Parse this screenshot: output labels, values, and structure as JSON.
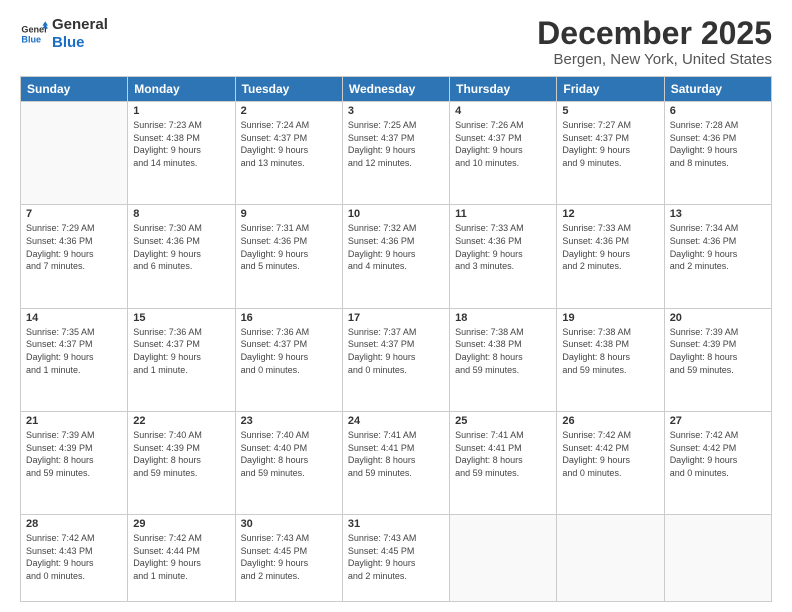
{
  "logo": {
    "line1": "General",
    "line2": "Blue"
  },
  "header": {
    "month": "December 2025",
    "location": "Bergen, New York, United States"
  },
  "weekdays": [
    "Sunday",
    "Monday",
    "Tuesday",
    "Wednesday",
    "Thursday",
    "Friday",
    "Saturday"
  ],
  "weeks": [
    [
      {
        "day": "",
        "info": ""
      },
      {
        "day": "1",
        "info": "Sunrise: 7:23 AM\nSunset: 4:38 PM\nDaylight: 9 hours\nand 14 minutes."
      },
      {
        "day": "2",
        "info": "Sunrise: 7:24 AM\nSunset: 4:37 PM\nDaylight: 9 hours\nand 13 minutes."
      },
      {
        "day": "3",
        "info": "Sunrise: 7:25 AM\nSunset: 4:37 PM\nDaylight: 9 hours\nand 12 minutes."
      },
      {
        "day": "4",
        "info": "Sunrise: 7:26 AM\nSunset: 4:37 PM\nDaylight: 9 hours\nand 10 minutes."
      },
      {
        "day": "5",
        "info": "Sunrise: 7:27 AM\nSunset: 4:37 PM\nDaylight: 9 hours\nand 9 minutes."
      },
      {
        "day": "6",
        "info": "Sunrise: 7:28 AM\nSunset: 4:36 PM\nDaylight: 9 hours\nand 8 minutes."
      }
    ],
    [
      {
        "day": "7",
        "info": "Sunrise: 7:29 AM\nSunset: 4:36 PM\nDaylight: 9 hours\nand 7 minutes."
      },
      {
        "day": "8",
        "info": "Sunrise: 7:30 AM\nSunset: 4:36 PM\nDaylight: 9 hours\nand 6 minutes."
      },
      {
        "day": "9",
        "info": "Sunrise: 7:31 AM\nSunset: 4:36 PM\nDaylight: 9 hours\nand 5 minutes."
      },
      {
        "day": "10",
        "info": "Sunrise: 7:32 AM\nSunset: 4:36 PM\nDaylight: 9 hours\nand 4 minutes."
      },
      {
        "day": "11",
        "info": "Sunrise: 7:33 AM\nSunset: 4:36 PM\nDaylight: 9 hours\nand 3 minutes."
      },
      {
        "day": "12",
        "info": "Sunrise: 7:33 AM\nSunset: 4:36 PM\nDaylight: 9 hours\nand 2 minutes."
      },
      {
        "day": "13",
        "info": "Sunrise: 7:34 AM\nSunset: 4:36 PM\nDaylight: 9 hours\nand 2 minutes."
      }
    ],
    [
      {
        "day": "14",
        "info": "Sunrise: 7:35 AM\nSunset: 4:37 PM\nDaylight: 9 hours\nand 1 minute."
      },
      {
        "day": "15",
        "info": "Sunrise: 7:36 AM\nSunset: 4:37 PM\nDaylight: 9 hours\nand 1 minute."
      },
      {
        "day": "16",
        "info": "Sunrise: 7:36 AM\nSunset: 4:37 PM\nDaylight: 9 hours\nand 0 minutes."
      },
      {
        "day": "17",
        "info": "Sunrise: 7:37 AM\nSunset: 4:37 PM\nDaylight: 9 hours\nand 0 minutes."
      },
      {
        "day": "18",
        "info": "Sunrise: 7:38 AM\nSunset: 4:38 PM\nDaylight: 8 hours\nand 59 minutes."
      },
      {
        "day": "19",
        "info": "Sunrise: 7:38 AM\nSunset: 4:38 PM\nDaylight: 8 hours\nand 59 minutes."
      },
      {
        "day": "20",
        "info": "Sunrise: 7:39 AM\nSunset: 4:39 PM\nDaylight: 8 hours\nand 59 minutes."
      }
    ],
    [
      {
        "day": "21",
        "info": "Sunrise: 7:39 AM\nSunset: 4:39 PM\nDaylight: 8 hours\nand 59 minutes."
      },
      {
        "day": "22",
        "info": "Sunrise: 7:40 AM\nSunset: 4:39 PM\nDaylight: 8 hours\nand 59 minutes."
      },
      {
        "day": "23",
        "info": "Sunrise: 7:40 AM\nSunset: 4:40 PM\nDaylight: 8 hours\nand 59 minutes."
      },
      {
        "day": "24",
        "info": "Sunrise: 7:41 AM\nSunset: 4:41 PM\nDaylight: 8 hours\nand 59 minutes."
      },
      {
        "day": "25",
        "info": "Sunrise: 7:41 AM\nSunset: 4:41 PM\nDaylight: 8 hours\nand 59 minutes."
      },
      {
        "day": "26",
        "info": "Sunrise: 7:42 AM\nSunset: 4:42 PM\nDaylight: 9 hours\nand 0 minutes."
      },
      {
        "day": "27",
        "info": "Sunrise: 7:42 AM\nSunset: 4:42 PM\nDaylight: 9 hours\nand 0 minutes."
      }
    ],
    [
      {
        "day": "28",
        "info": "Sunrise: 7:42 AM\nSunset: 4:43 PM\nDaylight: 9 hours\nand 0 minutes."
      },
      {
        "day": "29",
        "info": "Sunrise: 7:42 AM\nSunset: 4:44 PM\nDaylight: 9 hours\nand 1 minute."
      },
      {
        "day": "30",
        "info": "Sunrise: 7:43 AM\nSunset: 4:45 PM\nDaylight: 9 hours\nand 2 minutes."
      },
      {
        "day": "31",
        "info": "Sunrise: 7:43 AM\nSunset: 4:45 PM\nDaylight: 9 hours\nand 2 minutes."
      },
      {
        "day": "",
        "info": ""
      },
      {
        "day": "",
        "info": ""
      },
      {
        "day": "",
        "info": ""
      }
    ]
  ]
}
